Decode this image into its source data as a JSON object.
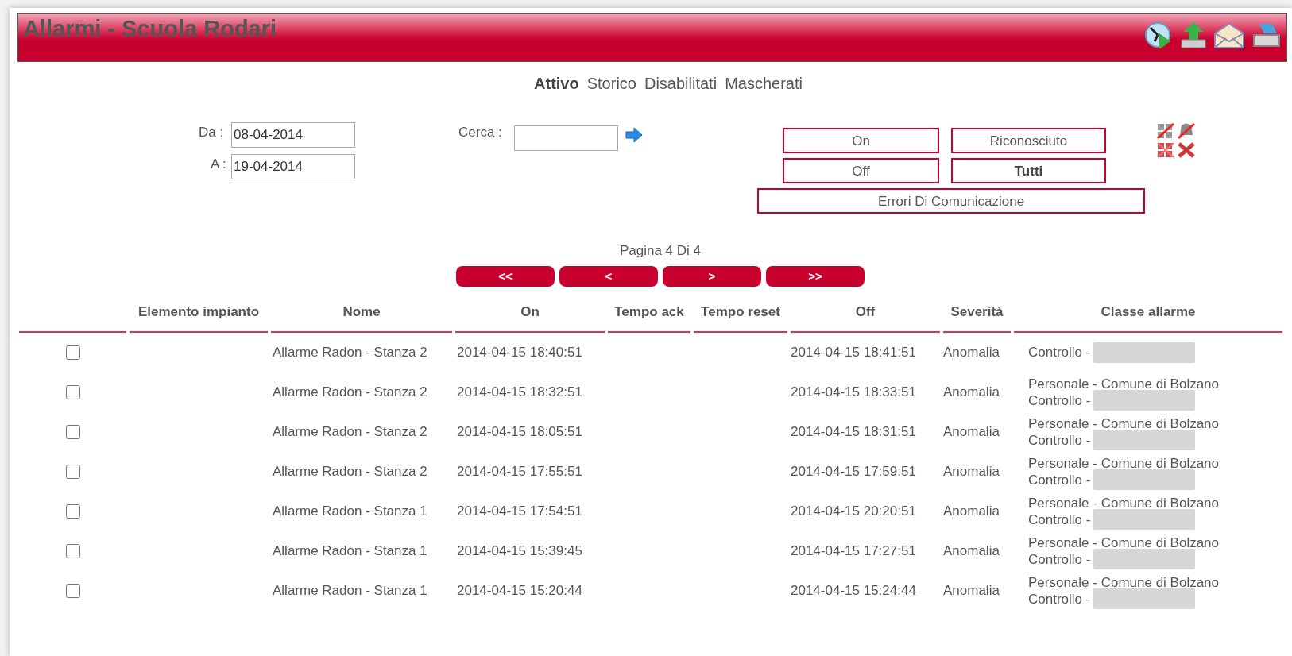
{
  "window": {
    "title": "Allarmi - Scuola Rodari"
  },
  "tabs": [
    {
      "label": "Attivo",
      "selected": true
    },
    {
      "label": "Storico",
      "selected": false
    },
    {
      "label": "Disabilitati",
      "selected": false
    },
    {
      "label": "Mascherati",
      "selected": false
    }
  ],
  "filters": {
    "from_label": "Da :",
    "from_value": "08-04-2014",
    "to_label": "A :",
    "to_value": "19-04-2014",
    "search_label": "Cerca :"
  },
  "state_buttons": [
    {
      "label": "On",
      "selected": false
    },
    {
      "label": "Riconosciuto",
      "selected": false
    },
    {
      "label": "Off",
      "selected": false
    },
    {
      "label": "Tutti",
      "selected": true
    },
    {
      "label": "Errori Di Comunicazione",
      "selected": false
    }
  ],
  "pagination": {
    "label": "Pagina 4 Di 4",
    "buttons": [
      "<<",
      "<",
      ">",
      ">>"
    ]
  },
  "table": {
    "columns": [
      "",
      "Elemento impianto",
      "Nome",
      "On",
      "Tempo ack",
      "Tempo reset",
      "Off",
      "Severità",
      "Classe allarme"
    ],
    "rows": [
      {
        "checked": false,
        "nome": "Allarme Radon - Stanza 2",
        "on": "2014-04-15 18:40:51",
        "off": "2014-04-15 18:41:51",
        "severita": "Anomalia",
        "classe": [
          {
            "text": "Controllo -",
            "redacted": true
          }
        ]
      },
      {
        "checked": false,
        "nome": "Allarme Radon - Stanza 2",
        "on": "2014-04-15 18:32:51",
        "off": "2014-04-15 18:33:51",
        "severita": "Anomalia",
        "classe": [
          {
            "text": "Personale - Comune di Bolzano",
            "redacted": false
          },
          {
            "text": "Controllo -",
            "redacted": true
          }
        ]
      },
      {
        "checked": false,
        "nome": "Allarme Radon - Stanza 2",
        "on": "2014-04-15 18:05:51",
        "off": "2014-04-15 18:31:51",
        "severita": "Anomalia",
        "classe": [
          {
            "text": "Personale - Comune di Bolzano",
            "redacted": false
          },
          {
            "text": "Controllo -",
            "redacted": true
          }
        ]
      },
      {
        "checked": false,
        "nome": "Allarme Radon - Stanza 2",
        "on": "2014-04-15 17:55:51",
        "off": "2014-04-15 17:59:51",
        "severita": "Anomalia",
        "classe": [
          {
            "text": "Personale - Comune di Bolzano",
            "redacted": false
          },
          {
            "text": "Controllo -",
            "redacted": true
          }
        ]
      },
      {
        "checked": false,
        "nome": "Allarme Radon - Stanza 1",
        "on": "2014-04-15 17:54:51",
        "off": "2014-04-15 20:20:51",
        "severita": "Anomalia",
        "classe": [
          {
            "text": "Personale - Comune di Bolzano",
            "redacted": false
          },
          {
            "text": "Controllo -",
            "redacted": true
          }
        ]
      },
      {
        "checked": false,
        "nome": "Allarme Radon - Stanza 1",
        "on": "2014-04-15 15:39:45",
        "off": "2014-04-15 17:27:51",
        "severita": "Anomalia",
        "classe": [
          {
            "text": "Personale - Comune di Bolzano",
            "redacted": false
          },
          {
            "text": "Controllo -",
            "redacted": true
          }
        ]
      },
      {
        "checked": false,
        "nome": "Allarme Radon - Stanza 1",
        "on": "2014-04-15 15:20:44",
        "off": "2014-04-15 15:24:44",
        "severita": "Anomalia",
        "classe": [
          {
            "text": "Personale - Comune di Bolzano",
            "redacted": false
          },
          {
            "text": "Controllo -",
            "redacted": true
          }
        ]
      }
    ]
  }
}
